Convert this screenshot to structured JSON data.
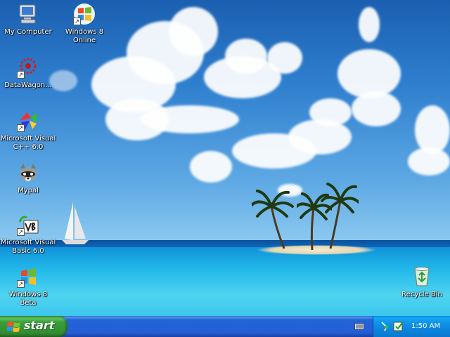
{
  "desktop": {
    "icons": [
      {
        "label": "My Computer",
        "icon": "my-computer-icon"
      },
      {
        "label": "Windows 8 Online",
        "icon": "windows-flag-icon"
      },
      {
        "label": "DataWagon...",
        "icon": "datawagon-icon"
      },
      {
        "label": "Microsoft Visual C++ 6.0",
        "icon": "visual-cpp-icon"
      },
      {
        "label": "Mypal",
        "icon": "raccoon-icon"
      },
      {
        "label": "Microsoft Visual Basic 6.0",
        "icon": "visual-basic-icon"
      },
      {
        "label": "Windows 8 Beta",
        "icon": "windows-flag-icon"
      },
      {
        "label": "Recycle Bin",
        "icon": "recycle-bin-icon"
      }
    ]
  },
  "taskbar": {
    "start_label": "start",
    "tray": {
      "clock": "1:50 AM",
      "icons": [
        "keyboard-icon",
        "network-icon",
        "security-icon"
      ]
    }
  },
  "colors": {
    "taskbar_blue": "#245ed6",
    "start_green": "#3a9f3a",
    "tray_blue": "#0f8fe6"
  }
}
